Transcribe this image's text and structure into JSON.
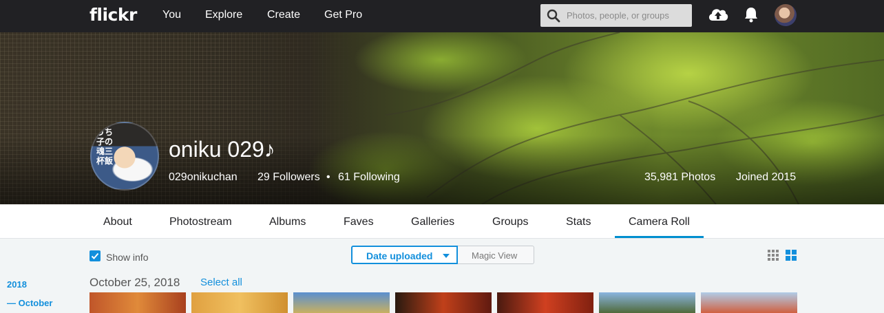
{
  "topnav": {
    "logo": "flickr",
    "links": [
      "You",
      "Explore",
      "Create",
      "Get Pro"
    ],
    "search_placeholder": "Photos, people, or groups"
  },
  "profile": {
    "avatar_text": "うち子の魂三杯飯",
    "display_name": "oniku 029♪",
    "username": "029onikuchan",
    "followers": "29 Followers",
    "separator": "•",
    "following": "61 Following",
    "photos": "35,981 Photos",
    "joined": "Joined 2015"
  },
  "subnav": {
    "tabs": [
      "About",
      "Photostream",
      "Albums",
      "Faves",
      "Galleries",
      "Groups",
      "Stats",
      "Camera Roll"
    ],
    "active_tab": "Camera Roll"
  },
  "toolbar": {
    "show_info_label": "Show info",
    "show_info_checked": true,
    "sort_selected": "Date uploaded",
    "sort_other": "Magic View"
  },
  "timeline": {
    "year": "2018",
    "month": "October",
    "date_heading": "October 25, 2018",
    "select_all": "Select all"
  },
  "colors": {
    "accent": "#128fdc",
    "topnav_bg": "#212124",
    "page_bg": "#f2f5f6"
  }
}
